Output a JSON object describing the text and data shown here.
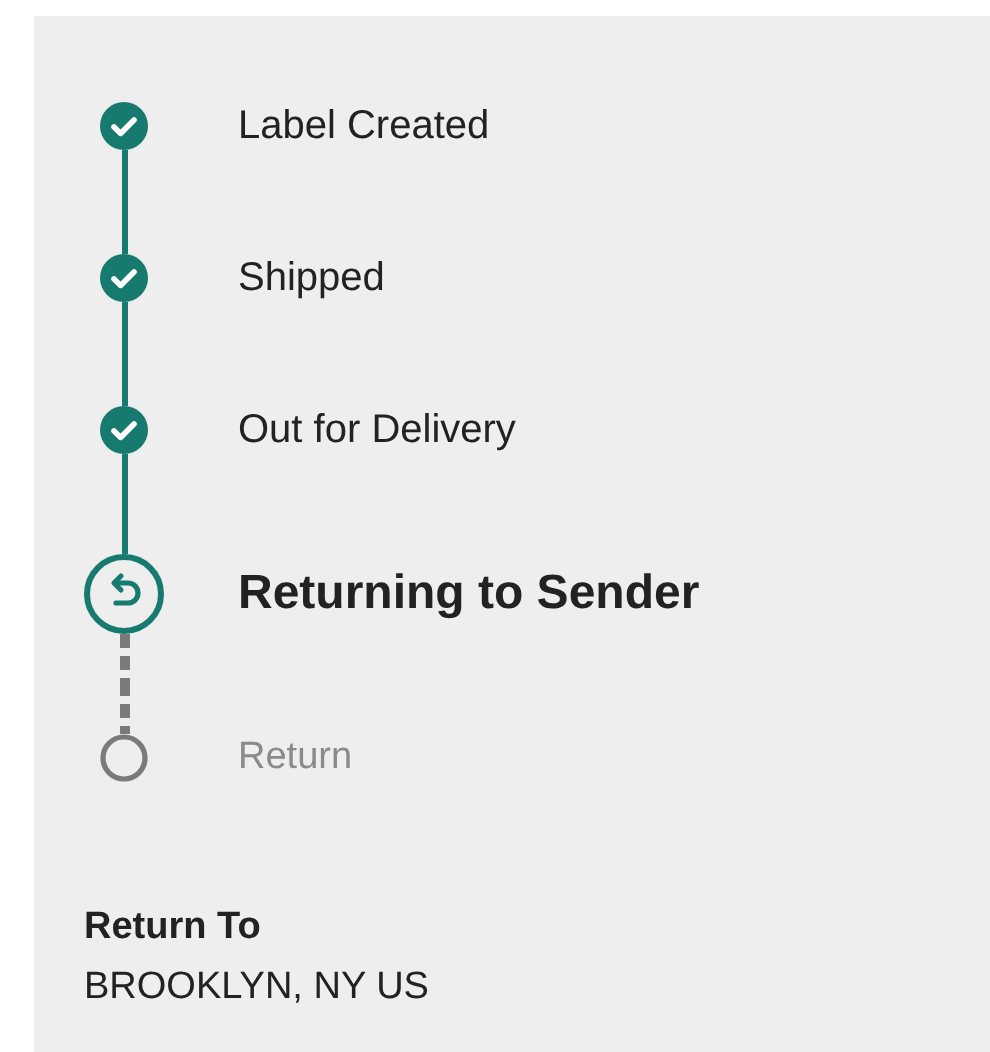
{
  "steps": [
    {
      "label": "Label Created",
      "kind": "done"
    },
    {
      "label": "Shipped",
      "kind": "done"
    },
    {
      "label": "Out for Delivery",
      "kind": "done"
    },
    {
      "label": "Returning to Sender",
      "kind": "current"
    },
    {
      "label": "Return",
      "kind": "pending"
    }
  ],
  "return_to": {
    "heading": "Return To",
    "value": "BROOKLYN, NY US"
  }
}
